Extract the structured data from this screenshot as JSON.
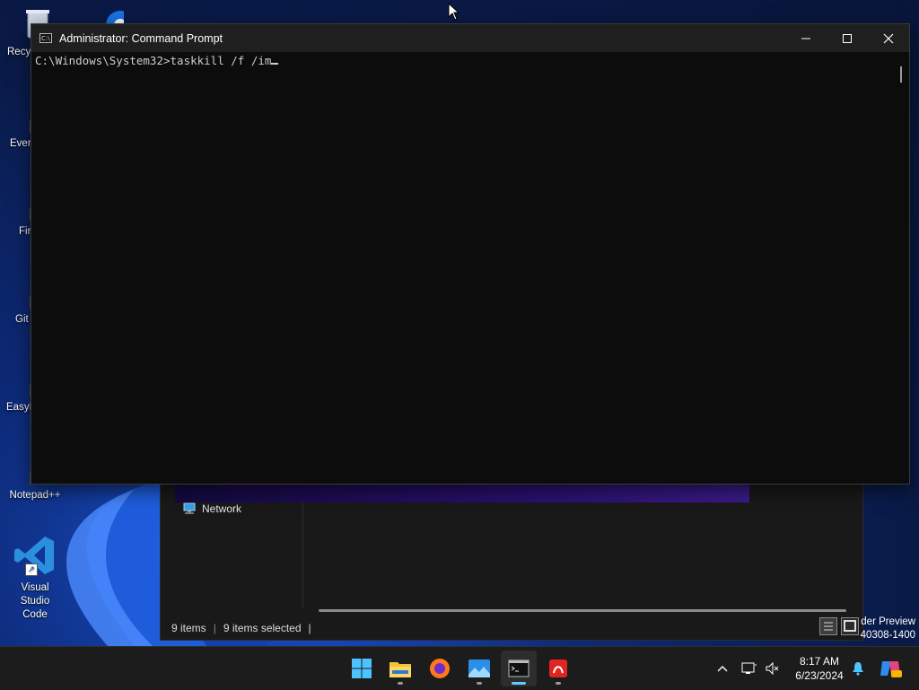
{
  "desktop": {
    "icons": [
      {
        "label": "Recy"
      },
      {
        "label": "Ever"
      },
      {
        "label": "Fir"
      },
      {
        "label": "Git"
      },
      {
        "label": "EasyE"
      },
      {
        "label": "Notepad++"
      },
      {
        "label": "Visual Studio Code"
      }
    ],
    "watermark_line1": "der Preview",
    "watermark_line2": "40308-1400"
  },
  "cmd_window": {
    "title": "Administrator: Command Prompt",
    "icon_text": "C:\\",
    "prompt": "C:\\Windows\\System32>",
    "typed_command": "taskkill /f /im",
    "minimize_icon": "minimize-icon",
    "maximize_icon": "maximize-icon",
    "close_icon": "close-icon"
  },
  "explorer": {
    "nav_item": "Network",
    "status_items": "9 items",
    "status_separator": "|",
    "status_selected": "9 items selected",
    "status_separator2": "|"
  },
  "taskbar": {
    "apps": [
      "start",
      "file-explorer",
      "firefox",
      "photos",
      "command-prompt",
      "acrobat"
    ],
    "active_app": "command-prompt",
    "time": "8:17 AM",
    "date": "6/23/2024"
  },
  "colors": {
    "accent": "#60cdff",
    "console_bg": "#0c0c0c",
    "console_text": "#cccccc",
    "taskbar_bg": "#1c1c1c"
  }
}
